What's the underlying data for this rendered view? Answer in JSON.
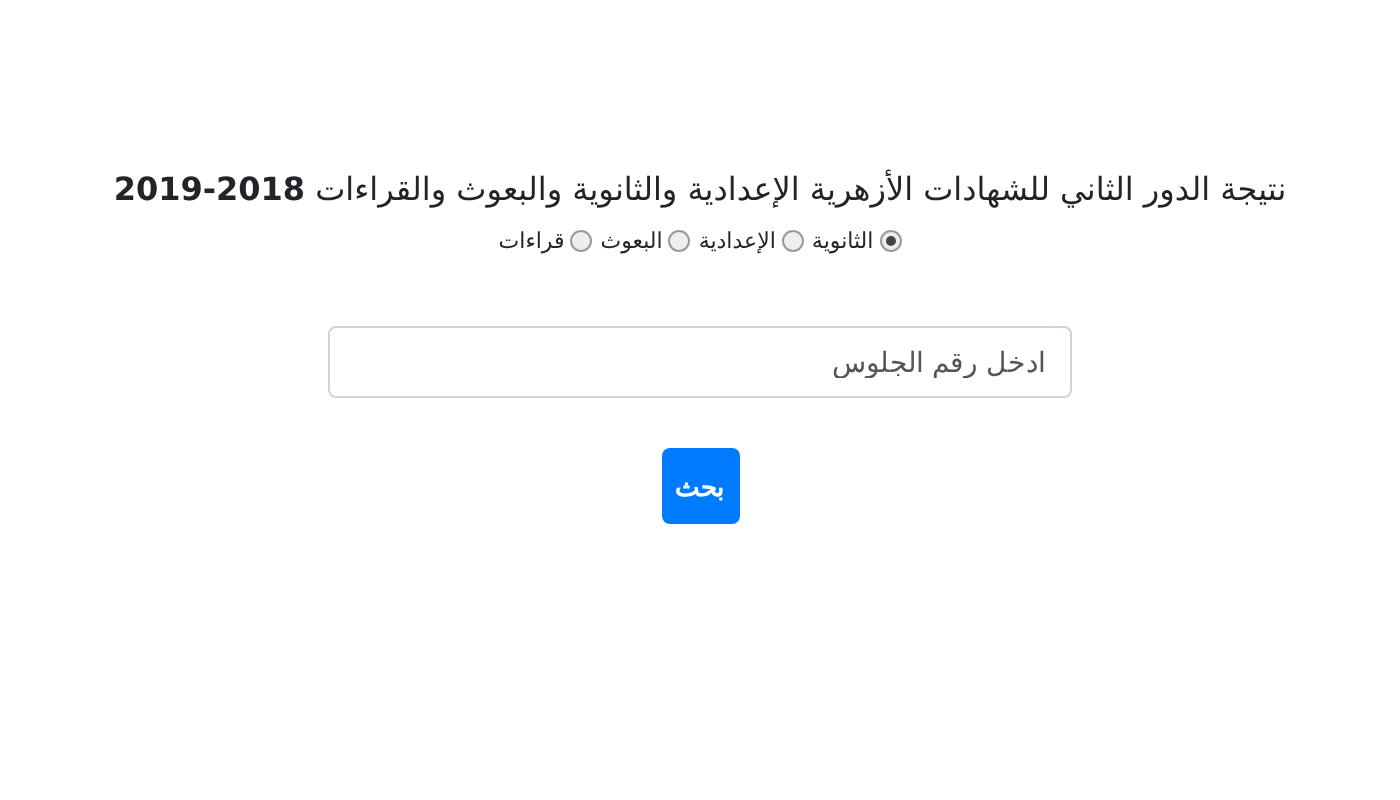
{
  "title": "نتيجة الدور الثاني للشهادات الأزهرية الإعدادية والثانوية والبعوث والقراءات **2018-2019**",
  "options": [
    {
      "label": "الثانوية",
      "selected": true
    },
    {
      "label": "الإعدادية",
      "selected": false
    },
    {
      "label": "البعوث",
      "selected": false
    },
    {
      "label": "قراءات",
      "selected": false
    }
  ],
  "search": {
    "placeholder": "ادخل رقم الجلوس"
  },
  "button": "بحث"
}
